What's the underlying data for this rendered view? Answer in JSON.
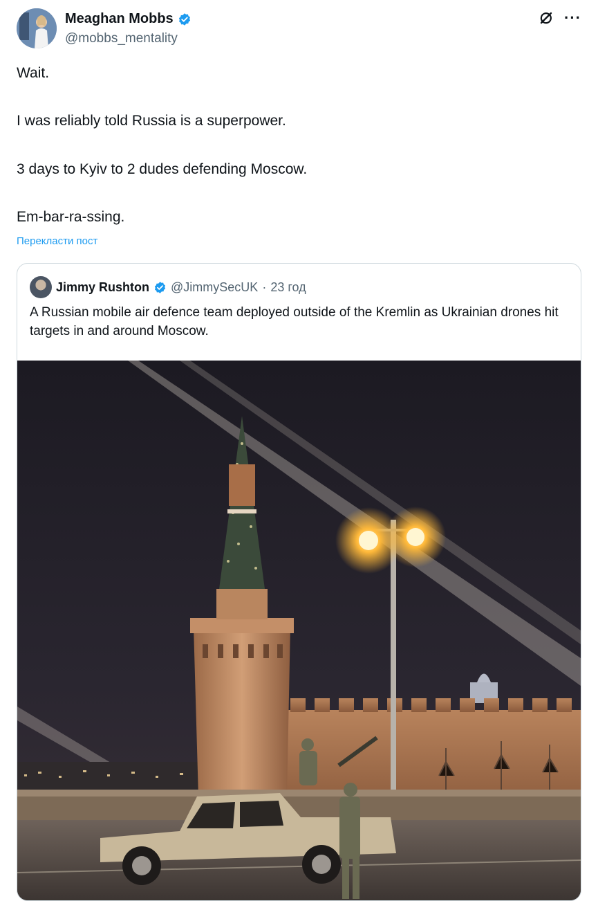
{
  "author": {
    "name": "Meaghan Mobbs",
    "handle": "@mobbs_mentality"
  },
  "icons": {
    "verified": "verified-badge-icon",
    "grok": "grok-icon",
    "more": "more-options-icon"
  },
  "tweet": {
    "lines": [
      "Wait.",
      "I was reliably told Russia is a superpower.",
      "3 days to Kyiv to 2 dudes defending Moscow.",
      "Em-bar-ra-ssing."
    ],
    "translate_label": "Перекласти пост"
  },
  "quote": {
    "name": "Jimmy Rushton",
    "handle": "@JimmySecUK",
    "separator": "·",
    "time": "23 год",
    "text": "A Russian mobile air defence team deployed outside of the Kremlin as Ukrainian drones hit targets in and around Moscow."
  },
  "colors": {
    "accent": "#1d9bf0",
    "text": "#0f1419",
    "secondary": "#536471",
    "border": "#cfd9de"
  }
}
